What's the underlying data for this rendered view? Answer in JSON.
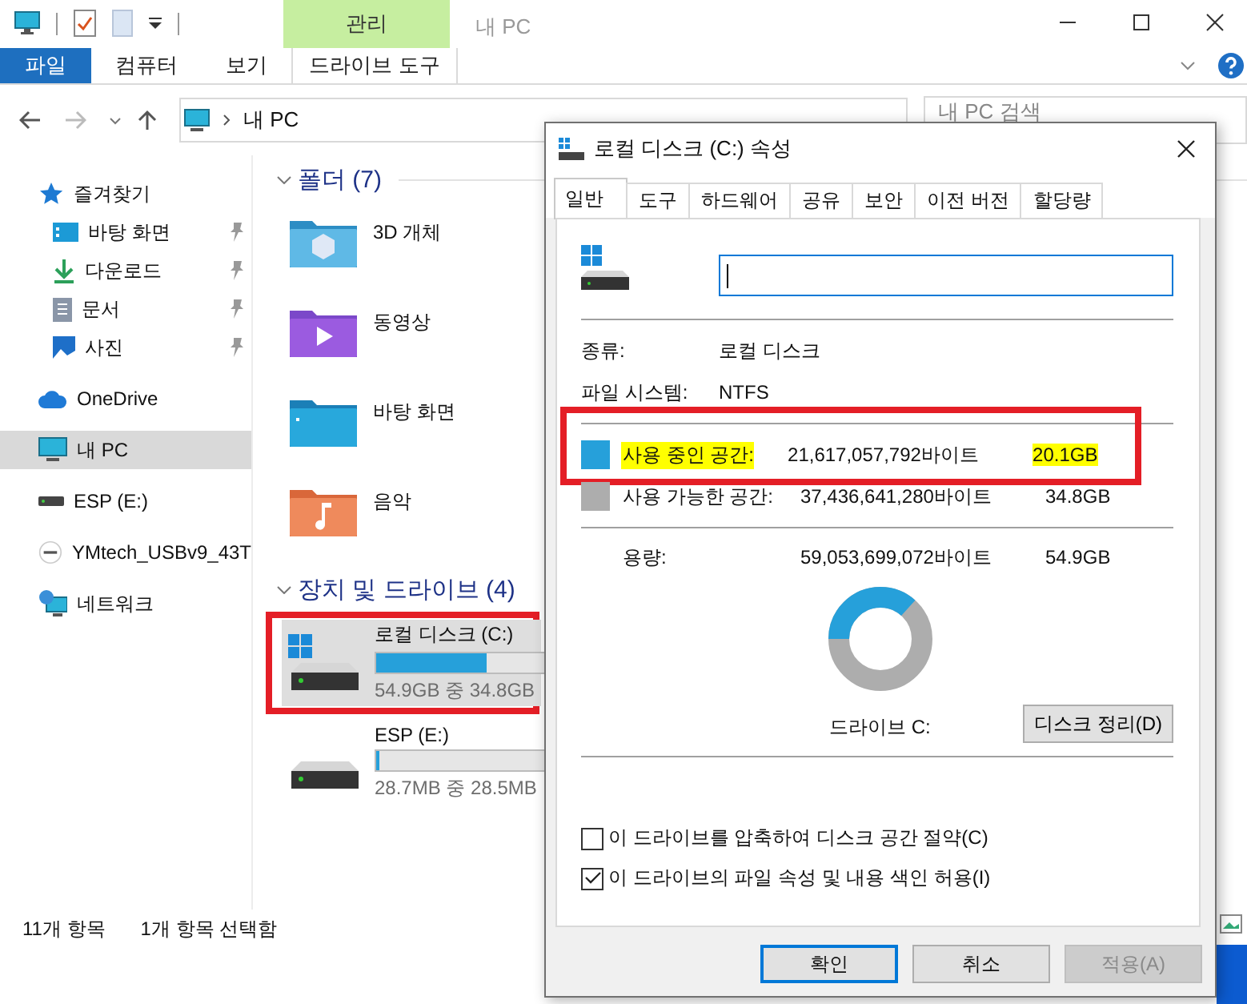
{
  "explorer": {
    "title": "내 PC",
    "context_group": "관리",
    "file_menu": "파일",
    "ribbon_tabs": [
      {
        "label": "컴퓨터",
        "kind": "normal"
      },
      {
        "label": "보기",
        "kind": "normal"
      },
      {
        "label": "드라이브 도구",
        "kind": "context"
      }
    ],
    "address": "내 PC",
    "search": {
      "placeholder": "내 PC 검색"
    },
    "nav": [
      {
        "label": "즐겨찾기",
        "kind": "star",
        "selected": false,
        "children": [
          {
            "label": "바탕 화면",
            "kind": "desktop",
            "pinned": true,
            "selected": false
          },
          {
            "label": "다운로드",
            "kind": "download",
            "pinned": true,
            "selected": false
          },
          {
            "label": "문서",
            "kind": "document",
            "pinned": true,
            "selected": false
          },
          {
            "label": "사진",
            "kind": "picture",
            "pinned": true,
            "selected": false
          }
        ]
      },
      {
        "label": "OneDrive",
        "kind": "cloud",
        "selected": false
      },
      {
        "label": "내 PC",
        "kind": "pc",
        "selected": true
      },
      {
        "label": "ESP (E:)",
        "kind": "drive",
        "selected": false
      },
      {
        "label": "YMtech_USBv9_43T",
        "kind": "usb",
        "selected": false
      },
      {
        "label": "네트워크",
        "kind": "network",
        "selected": false
      }
    ],
    "folders_heading": "폴더 (7)",
    "folders": [
      {
        "name": "3D 개체",
        "kind": "objects"
      },
      {
        "name": "동영상",
        "kind": "video"
      },
      {
        "name": "바탕 화면",
        "kind": "desktop"
      },
      {
        "name": "음악",
        "kind": "music"
      }
    ],
    "drives_heading": "장치 및 드라이브 (4)",
    "drives": [
      {
        "name": "로컬 디스크 (C:)",
        "kind": "system",
        "level": 0.37,
        "space": "54.9GB 중 34.8GB",
        "selected": true,
        "boxed": true
      },
      {
        "name": "ESP (E:)",
        "kind": "drive",
        "level": 0.01,
        "space": "28.7MB 중 28.5MB",
        "selected": false,
        "boxed": false
      }
    ],
    "status_bar": [
      "11개 항목",
      "1개 항목 선택함"
    ]
  },
  "dialog": {
    "title": "로컬 디스크 (C:) 속성",
    "tabs": [
      {
        "label": "일반",
        "selected": true
      },
      {
        "label": "도구",
        "selected": false
      },
      {
        "label": "하드웨어",
        "selected": false
      },
      {
        "label": "공유",
        "selected": false
      },
      {
        "label": "보안",
        "selected": false
      },
      {
        "label": "이전 버전",
        "selected": false
      },
      {
        "label": "할당량",
        "selected": false
      }
    ],
    "info": [
      {
        "label": "종류:",
        "value": "로컬 디스크"
      },
      {
        "label": "파일 시스템:",
        "value": "NTFS"
      }
    ],
    "space": [
      {
        "label": "사용 중인 공간:",
        "bytes": "21,617,057,792바이트",
        "size": "20.1GB",
        "color": "#26a0da",
        "highlighted": true,
        "boxed": true
      },
      {
        "label": "사용 가능한 공간:",
        "bytes": "37,436,641,280바이트",
        "size": "34.8GB",
        "color": "#adadad",
        "highlighted": false,
        "boxed": false
      }
    ],
    "capacity": {
      "label": "용량:",
      "bytes": "59,053,699,072바이트",
      "size": "54.9GB"
    },
    "usage": {
      "level": 0.366
    },
    "drive_label": "드라이브 C:",
    "cleanup_button": "디스크 정리(D)",
    "options": [
      {
        "label": "이 드라이브를 압축하여 디스크 공간 절약(C)",
        "checked": false
      },
      {
        "label": "이 드라이브의 파일 속성 및 내용 색인 허용(I)",
        "checked": true
      }
    ],
    "buttons": [
      {
        "label": "확인",
        "kind": "default"
      },
      {
        "label": "취소",
        "kind": "normal"
      },
      {
        "label": "적용(A)",
        "kind": "disabled"
      }
    ]
  }
}
